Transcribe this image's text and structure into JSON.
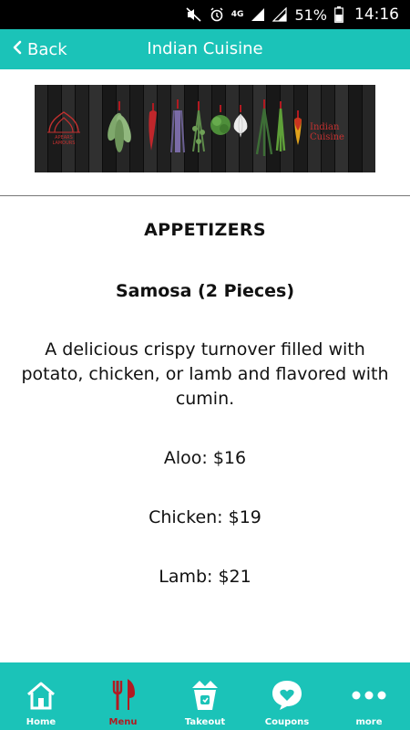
{
  "status_bar": {
    "battery_percent": "51%",
    "time": "14:16",
    "network": "4G"
  },
  "header": {
    "back_label": "Back",
    "title": "Indian Cuisine"
  },
  "banner": {
    "caption": "Indian Cuisine",
    "logo_text": "APEARS LAMOURS"
  },
  "menu": {
    "section": "APPETIZERS",
    "item_name": "Samosa (2 Pieces)",
    "description": "A delicious crispy turnover filled with potato, chicken, or lamb and flavored with cumin.",
    "prices": [
      "Aloo:  $16",
      "Chicken:  $19",
      "Lamb: $21"
    ]
  },
  "bottom_nav": {
    "items": [
      {
        "label": "Home",
        "icon": "home-icon"
      },
      {
        "label": "Menu",
        "icon": "fork-knife-icon",
        "active": true
      },
      {
        "label": "Takeout",
        "icon": "takeout-box-icon"
      },
      {
        "label": "Coupons",
        "icon": "heart-bubble-icon"
      },
      {
        "label": "more",
        "icon": "more-dots-icon"
      }
    ]
  },
  "colors": {
    "accent": "#1bc3b8",
    "active": "#b11a21",
    "banner_text": "#c2302f"
  }
}
